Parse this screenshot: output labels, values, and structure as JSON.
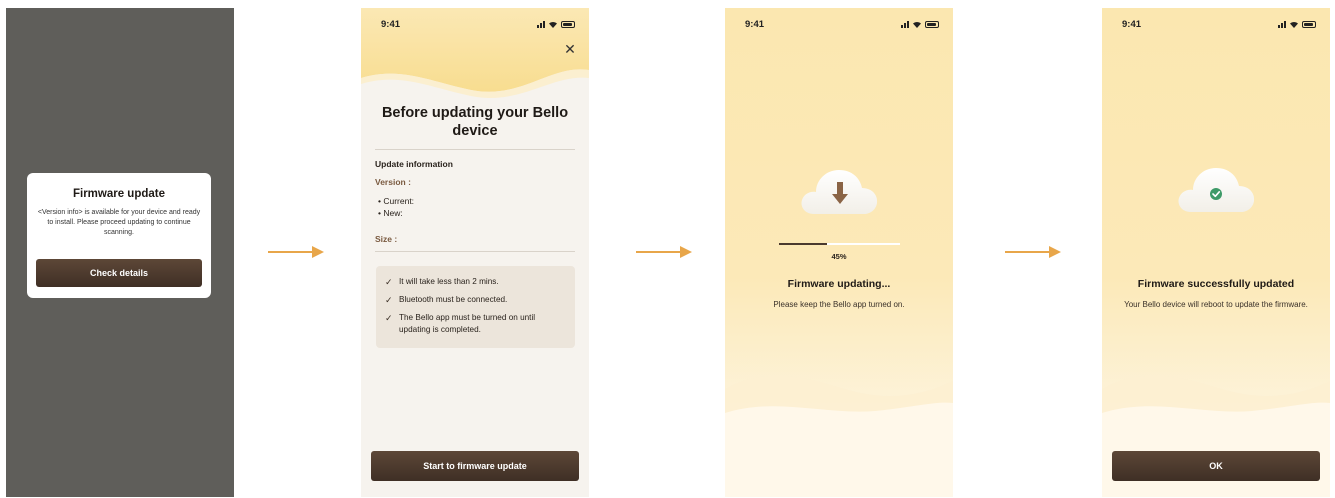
{
  "status": {
    "time": "9:41"
  },
  "screen1": {
    "title": "Firmware update",
    "body": "<Version info> is available for your device and ready to install. Please proceed updating to continue scanning.",
    "button": "Check details"
  },
  "screen2": {
    "title": "Before updating your Bello device",
    "section": "Update information",
    "version_label": "Version :",
    "current_label": "• Current:",
    "new_label": "• New:",
    "size_label": "Size :",
    "checks": [
      "It will take less than 2 mins.",
      "Bluetooth must be connected.",
      "The Bello app must be turned on until updating is completed."
    ],
    "button": "Start to firmware update"
  },
  "screen3": {
    "progress": 0.4,
    "percent_text": "45%",
    "title": "Firmware updating...",
    "subtitle": "Please keep the Bello app turned on."
  },
  "screen4": {
    "title": "Firmware successfully updated",
    "subtitle": "Your Bello device will reboot to update the firmware.",
    "button": "OK"
  },
  "colors": {
    "accent_arrow": "#e8a64a",
    "button_dark": "#4a392c",
    "backdrop": "#5f5e5a",
    "success_green": "#3e9a68",
    "warm_yellow": "#fbe7b0"
  },
  "icons": [
    "close-icon",
    "arrow-right-icon",
    "cloud-download-icon",
    "cloud-check-icon",
    "checkmark-icon",
    "signal-icon",
    "wifi-icon",
    "battery-icon"
  ]
}
